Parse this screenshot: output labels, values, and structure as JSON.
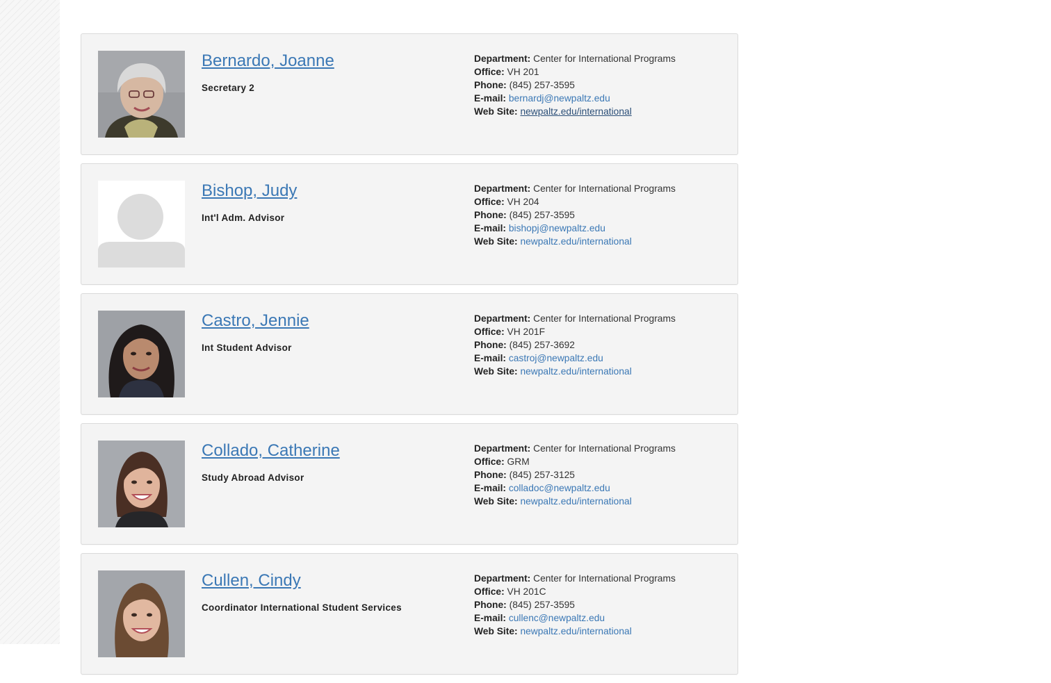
{
  "labels": {
    "department": "Department:",
    "office": "Office:",
    "phone": "Phone:",
    "email": "E-mail:",
    "website": "Web Site:"
  },
  "people": [
    {
      "name": "Bernardo, Joanne",
      "title": "Secretary 2",
      "department": "Center for International Programs",
      "office": "VH 201",
      "phone": "(845) 257-3595",
      "email": "bernardj@newpaltz.edu",
      "website": "newpaltz.edu/international",
      "photo": "portrait-photo"
    },
    {
      "name": "Bishop, Judy",
      "title": "Int'l Adm. Advisor",
      "department": "Center for International Programs",
      "office": "VH 204",
      "phone": "(845) 257-3595",
      "email": "bishopj@newpaltz.edu",
      "website": "newpaltz.edu/international",
      "photo": "placeholder-avatar"
    },
    {
      "name": "Castro, Jennie",
      "title": "Int Student Advisor",
      "department": "Center for International Programs",
      "office": "VH 201F",
      "phone": "(845) 257-3692",
      "email": "castroj@newpaltz.edu",
      "website": "newpaltz.edu/international",
      "photo": "portrait-photo"
    },
    {
      "name": "Collado, Catherine",
      "title": "Study Abroad Advisor",
      "department": "Center for International Programs",
      "office": "GRM",
      "phone": "(845) 257-3125",
      "email": "colladoc@newpaltz.edu",
      "website": "newpaltz.edu/international",
      "photo": "portrait-photo"
    },
    {
      "name": "Cullen, Cindy",
      "title": "Coordinator International Student Services",
      "department": "Center for International Programs",
      "office": "VH 201C",
      "phone": "(845) 257-3595",
      "email": "cullenc@newpaltz.edu",
      "website": "newpaltz.edu/international",
      "photo": "portrait-photo"
    }
  ],
  "colors": {
    "link": "#3b78b5",
    "card_background": "#f4f4f4",
    "card_border": "#dadada",
    "placeholder_avatar": "#dcdcdc"
  }
}
